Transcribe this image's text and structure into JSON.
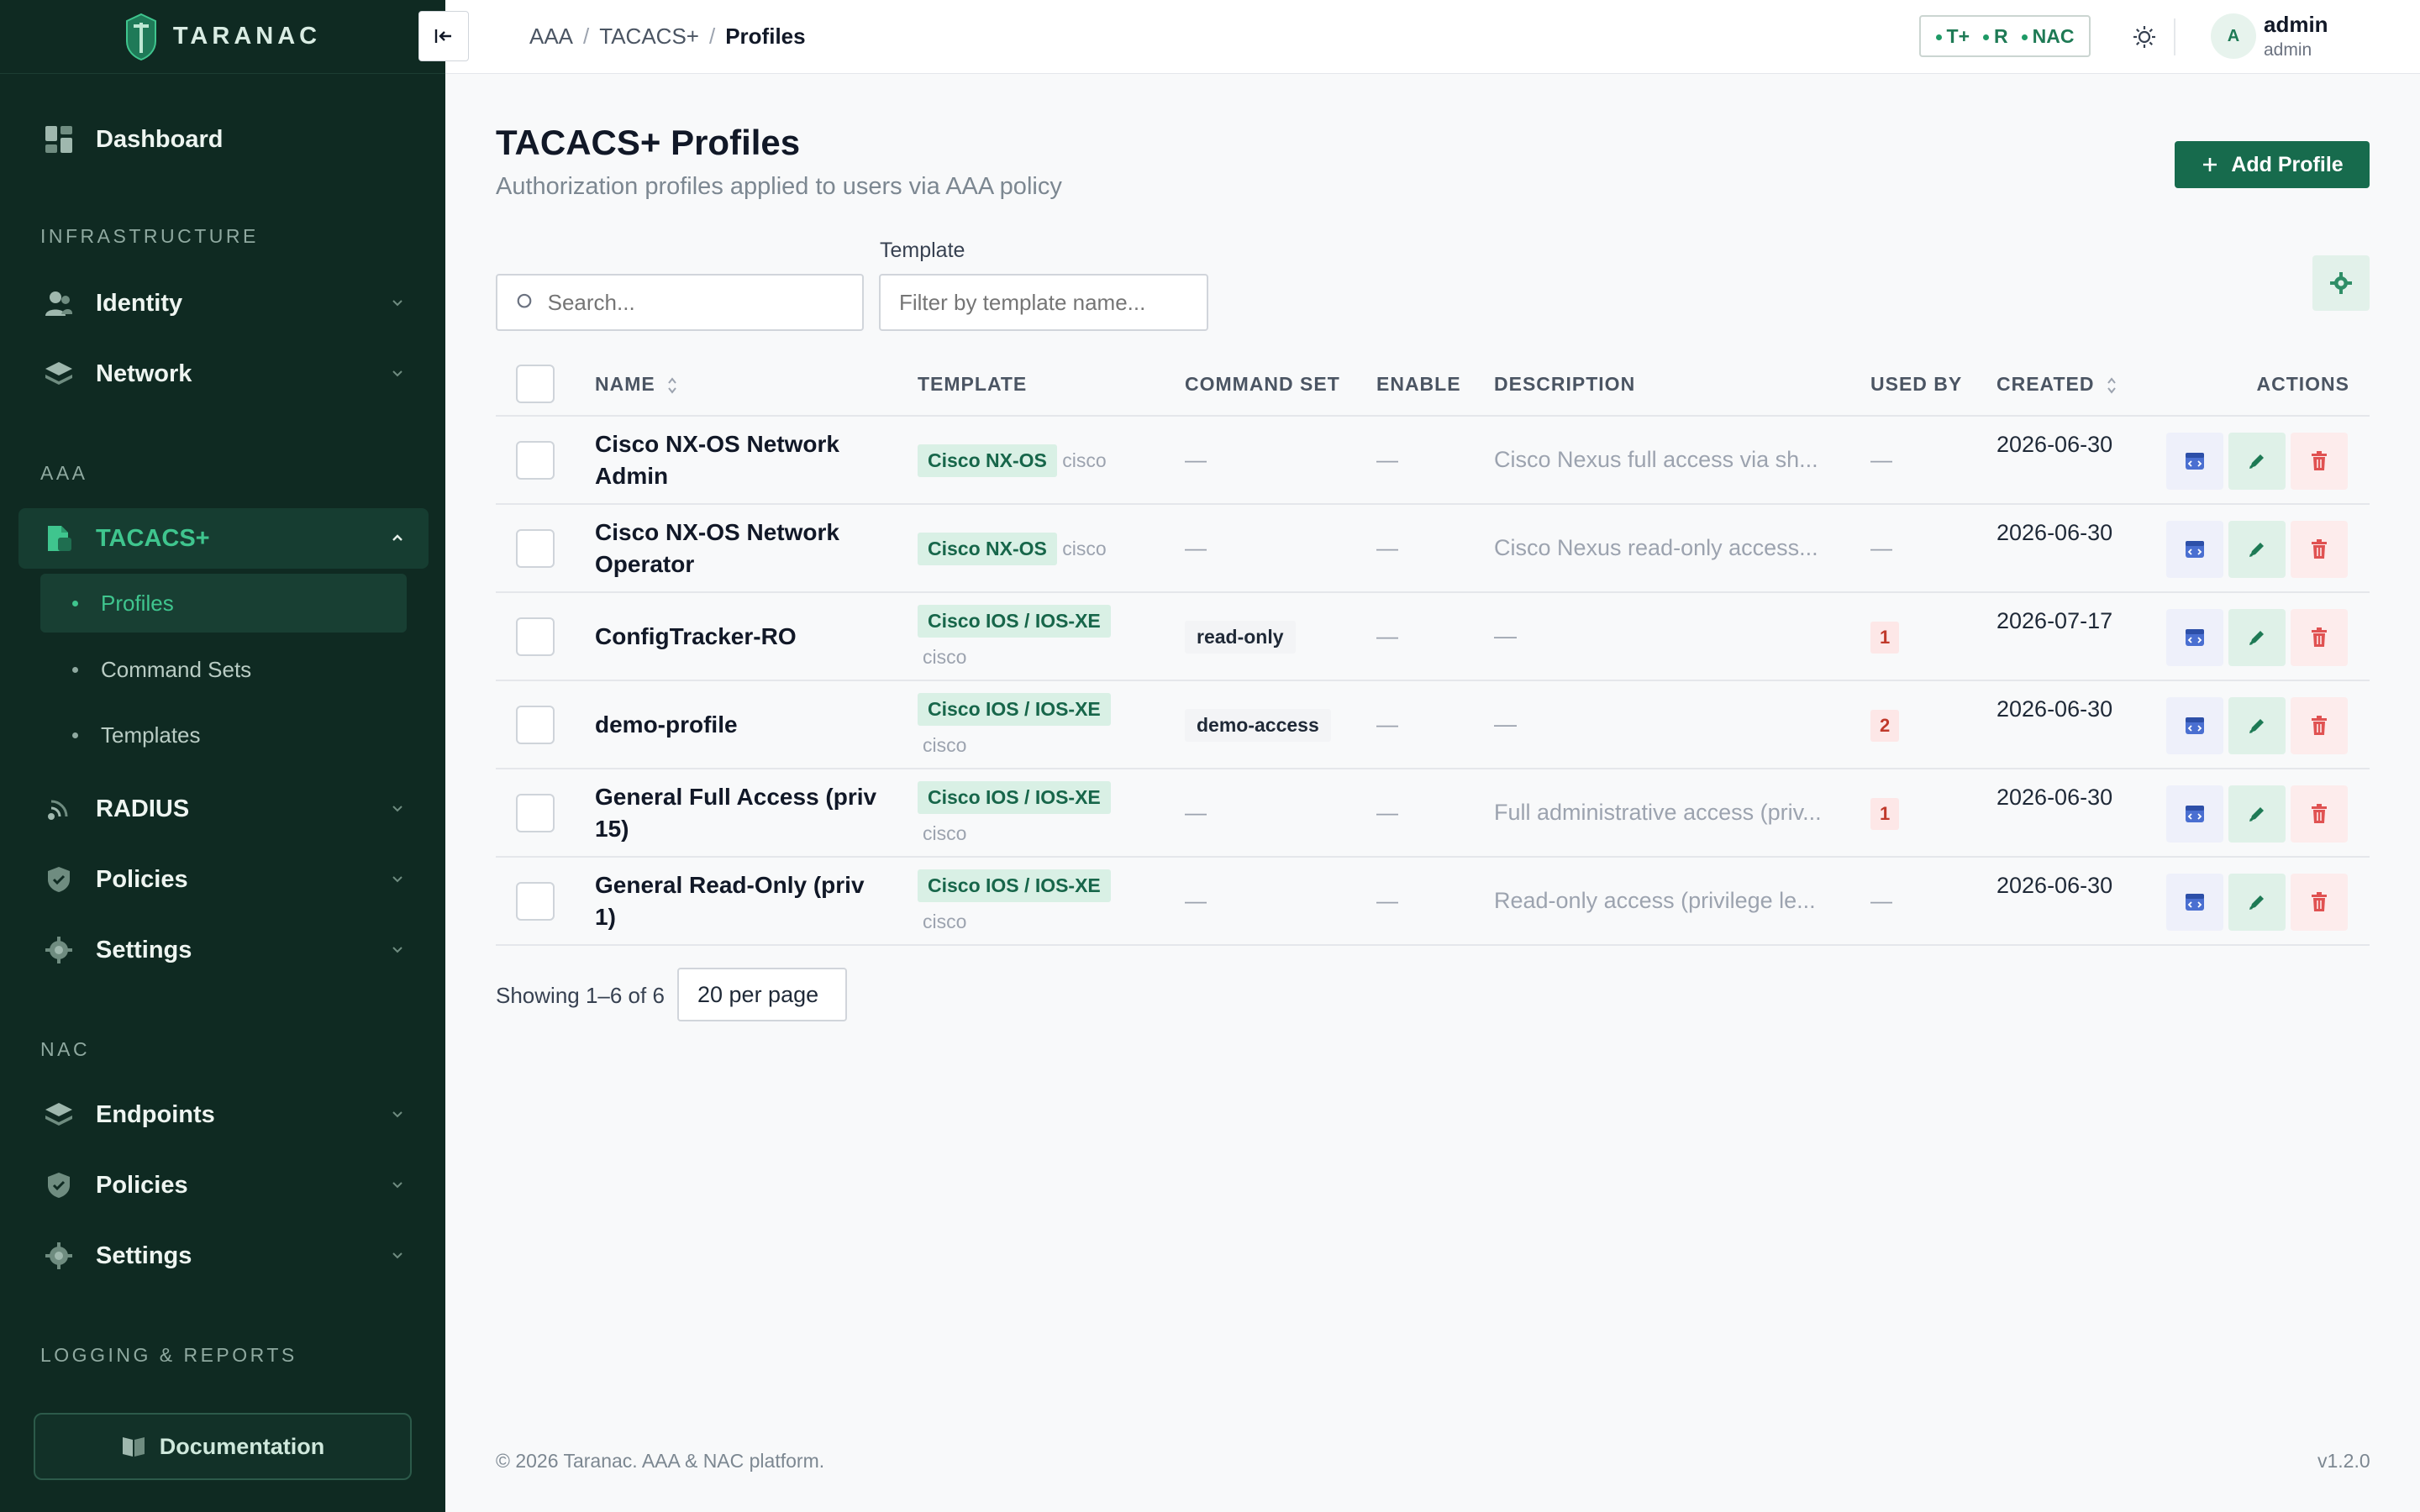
{
  "brand": {
    "name": "TARANAC"
  },
  "sidebar": {
    "dashboard": "Dashboard",
    "sections": {
      "infrastructure": "INFRASTRUCTURE",
      "aaa": "AAA",
      "nac": "NAC",
      "logging": "LOGGING & REPORTS"
    },
    "identity": "Identity",
    "network": "Network",
    "tacacs": "TACACS+",
    "tacacs_sub": {
      "profiles": "Profiles",
      "command_sets": "Command Sets",
      "templates": "Templates"
    },
    "radius": "RADIUS",
    "aaa_policies": "Policies",
    "aaa_settings": "Settings",
    "endpoints": "Endpoints",
    "nac_policies": "Policies",
    "nac_settings": "Settings",
    "documentation": "Documentation"
  },
  "topbar": {
    "breadcrumb": [
      "AAA",
      "TACACS+",
      "Profiles"
    ],
    "protocols": [
      "T+",
      "R",
      "NAC"
    ],
    "user": {
      "initial": "A",
      "name": "admin",
      "role": "admin"
    }
  },
  "page": {
    "title": "TACACS+ Profiles",
    "subtitle": "Authorization profiles applied to users via AAA policy",
    "add_button": "Add Profile",
    "search_placeholder": "Search...",
    "template_label": "Template",
    "template_placeholder": "Filter by template name..."
  },
  "table": {
    "columns": [
      "NAME",
      "TEMPLATE",
      "COMMAND SET",
      "ENABLE",
      "DESCRIPTION",
      "USED BY",
      "CREATED",
      "ACTIONS"
    ],
    "rows": [
      {
        "name": "Cisco NX-OS Network Admin",
        "template": "Cisco NX-OS",
        "vendor": "cisco",
        "command_set": "—",
        "enable": "—",
        "description": "Cisco Nexus full access via sh...",
        "used_by": "—",
        "created": "2026-06-30"
      },
      {
        "name": "Cisco NX-OS Network Operator",
        "template": "Cisco NX-OS",
        "vendor": "cisco",
        "command_set": "—",
        "enable": "—",
        "description": "Cisco Nexus read-only access...",
        "used_by": "—",
        "created": "2026-06-30"
      },
      {
        "name": "ConfigTracker-RO",
        "template": "Cisco IOS / IOS-XE",
        "vendor": "cisco",
        "command_set": "read-only",
        "enable": "—",
        "description": "—",
        "used_by": "1",
        "created": "2026-07-17"
      },
      {
        "name": "demo-profile",
        "template": "Cisco IOS / IOS-XE",
        "vendor": "cisco",
        "command_set": "demo-access",
        "enable": "—",
        "description": "—",
        "used_by": "2",
        "created": "2026-06-30"
      },
      {
        "name": "General Full Access (priv 15)",
        "template": "Cisco IOS / IOS-XE",
        "vendor": "cisco",
        "command_set": "—",
        "enable": "—",
        "description": "Full administrative access (priv...",
        "used_by": "1",
        "created": "2026-06-30"
      },
      {
        "name": "General Read-Only (priv 1)",
        "template": "Cisco IOS / IOS-XE",
        "vendor": "cisco",
        "command_set": "—",
        "enable": "—",
        "description": "Read-only access (privilege le...",
        "used_by": "—",
        "created": "2026-06-30"
      }
    ]
  },
  "pagination": {
    "showing": "Showing 1–6 of 6",
    "per_page": "20 per page"
  },
  "footer": {
    "copyright": "© 2026 Taranac. AAA & NAC platform.",
    "version": "v1.2.0"
  },
  "colors": {
    "sidebar_bg": "#0f2a22",
    "accent": "#176b4d",
    "active_text": "#3fc58e",
    "tag_bg": "#d9f0e5",
    "danger": "#c0392b"
  }
}
